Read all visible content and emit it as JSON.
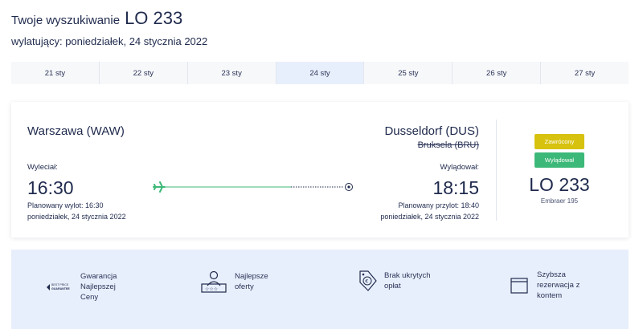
{
  "header": {
    "title_prefix": "Twoje wyszukiwanie",
    "flight_number": "LO 233",
    "subtitle": "wylatujący: poniedziałek, 24 stycznia 2022"
  },
  "dates": [
    {
      "label": "21 sty"
    },
    {
      "label": "22 sty"
    },
    {
      "label": "23 sty"
    },
    {
      "label": "24 sty",
      "active": true
    },
    {
      "label": "25 sty"
    },
    {
      "label": "26 sty"
    },
    {
      "label": "27 sty"
    }
  ],
  "flight": {
    "origin": "Warszawa (WAW)",
    "destination": "Dusseldorf (DUS)",
    "original_destination": "Bruksela (BRU)",
    "departure_label": "Wyleciał:",
    "departure_time": "16:30",
    "departure_planned": "Planowany wylot: 16:30",
    "departure_date": "poniedziałek, 24 stycznia 2022",
    "arrival_label": "Wylądował:",
    "arrival_time": "18:15",
    "arrival_planned": "Planowany przylot: 18:40",
    "arrival_date": "poniedziałek, 24 stycznia 2022",
    "status_returned": "Zawrócony",
    "status_landed": "Wylądował",
    "number": "LO 233",
    "aircraft": "Embraer 195"
  },
  "colors": {
    "text": "#1f2a4d",
    "active_date": "#e8effc",
    "returned": "#d7c20f",
    "landed": "#3cb878",
    "route_line": "#3cb878",
    "benefits_bg": "#e8effc"
  },
  "benefits": {
    "b1": {
      "line1": "Gwarancja",
      "line2": "Najlepszej",
      "line3": "Ceny",
      "icon": "best-price-guarantee-icon",
      "badge_top": "BEST PRICE",
      "badge_bottom": "GUARANTEE"
    },
    "b2": {
      "line1": "Najlepsze",
      "line2": "oferty",
      "icon": "best-offers-icon"
    },
    "b3": {
      "line1": "Brak ukrytych",
      "line2": "opłat",
      "icon": "price-tag-icon"
    },
    "b4": {
      "line1": "Szybsza",
      "line2": "rezerwacja z",
      "line3": "kontem",
      "icon": "browser-window-icon"
    }
  }
}
